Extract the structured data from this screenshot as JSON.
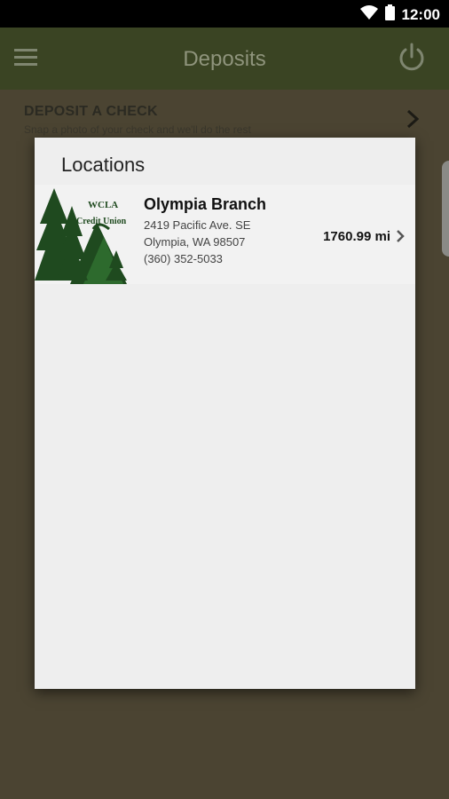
{
  "status_bar": {
    "time": "12:00"
  },
  "app_bar": {
    "title": "Deposits"
  },
  "background": {
    "deposit_title": "DEPOSIT A CHECK",
    "deposit_subtitle": "Snap a photo of your check and we'll do the rest"
  },
  "dialog": {
    "title": "Locations",
    "locations": [
      {
        "name": "Olympia Branch",
        "address_line1": "2419 Pacific Ave. SE",
        "address_line2": "Olympia, WA 98507",
        "phone": "(360) 352-5033",
        "distance": "1760.99 mi",
        "logo_text_line1": "WCLA",
        "logo_text_line2": "Credit Union"
      }
    ]
  },
  "colors": {
    "app_bar": "#3a4423",
    "backdrop": "#4b4432",
    "dialog_bg": "#eeeeee",
    "logo_green": "#1f4a1f"
  }
}
